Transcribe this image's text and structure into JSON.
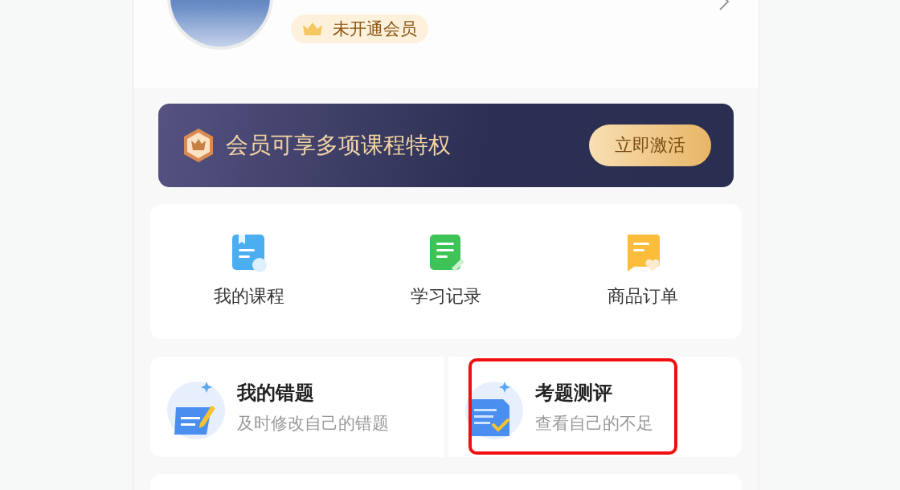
{
  "profile": {
    "badge": "未开通会员"
  },
  "banner": {
    "text": "会员可享多项课程特权",
    "button": "立即激活"
  },
  "shortcuts": [
    {
      "label": "我的课程"
    },
    {
      "label": "学习记录"
    },
    {
      "label": "商品订单"
    }
  ],
  "tools": [
    {
      "title": "我的错题",
      "subtitle": "及时修改自己的错题",
      "highlighted": false
    },
    {
      "title": "考题测评",
      "subtitle": "查看自己的不足",
      "highlighted": true
    }
  ]
}
